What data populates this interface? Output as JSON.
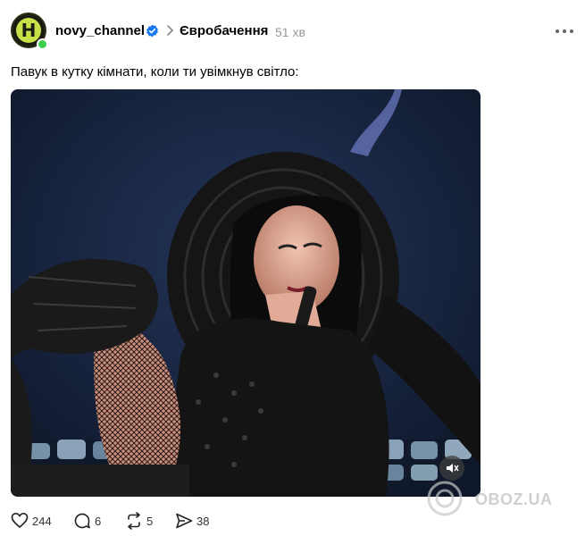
{
  "post": {
    "author": "novy_channel",
    "avatar_letter": "H",
    "topic": "Євробачення",
    "time": "51 хв",
    "caption": "Павук в кутку кімнати, коли ти увімкнув світло:"
  },
  "media": {
    "type": "video",
    "muted": true
  },
  "actions": {
    "likes": "244",
    "replies": "6",
    "reposts": "5",
    "shares": "38"
  },
  "watermark": {
    "text": "OBOZ.UA"
  },
  "colors": {
    "verified": "#1877f2",
    "online": "#3bd04c",
    "avatar_bg": "#c8e04a"
  }
}
